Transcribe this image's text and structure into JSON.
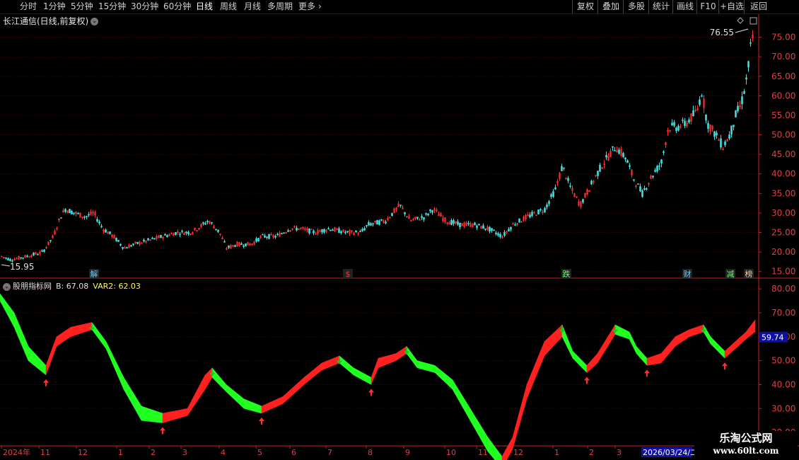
{
  "toolbar": {
    "periods": [
      "分时",
      "1分钟",
      "5分钟",
      "15分钟",
      "30分钟",
      "60分钟",
      "日线",
      "周线",
      "月线",
      "多周期",
      "更多"
    ],
    "active": "日线",
    "more_arrow": "chevron-right-icon",
    "right_buttons": [
      "复权",
      "叠加",
      "多股",
      "统计",
      "画线",
      "F10",
      "+自选",
      "返回"
    ]
  },
  "main_chart": {
    "title": "长江通信(日线,前复权)",
    "high_label": "76.55",
    "low_label": "15.95",
    "y_ticks": [
      "75.00",
      "70.00",
      "65.00",
      "60.00",
      "55.00",
      "50.00",
      "45.00",
      "40.00",
      "35.00",
      "30.00",
      "25.00",
      "20.00",
      "15.00"
    ],
    "markers": [
      {
        "text": "解",
        "color": "#66ccff"
      },
      {
        "text": "$",
        "color": "#ff3333"
      },
      {
        "text": "跌",
        "color": "#66ff66"
      },
      {
        "text": "财",
        "color": "#66ccff"
      },
      {
        "text": "减",
        "color": "#66ff66"
      },
      {
        "text": "榜",
        "color": "#ffcc88"
      }
    ]
  },
  "indicator": {
    "name": "股朋指标网",
    "b_label": "B: 67.08",
    "var2_label": "VAR2: 62.03",
    "y_ticks": [
      "80.00",
      "70.00",
      "60.00",
      "50.00",
      "40.00",
      "30.00",
      "20.00"
    ],
    "current_value": "59.74"
  },
  "x_axis": {
    "labels": [
      "2024年",
      "11",
      "12",
      "1",
      "2",
      "3",
      "4",
      "5",
      "6",
      "7",
      "8",
      "9",
      "10",
      "11",
      "12",
      "1",
      "2",
      "3"
    ],
    "cursor_date": "2026/03/24/二"
  },
  "watermark": {
    "line1": "乐淘公式网",
    "line2": "www.60lt.com"
  },
  "colors": {
    "up": "#ff2020",
    "down": "#20ff20",
    "grid": "#5a0000",
    "axis": "#cc2222"
  },
  "chart_data": {
    "type": "candlestick",
    "price_series": [
      [
        0,
        19
      ],
      [
        15,
        18
      ],
      [
        40,
        19
      ],
      [
        60,
        20
      ],
      [
        75,
        24
      ],
      [
        85,
        29
      ],
      [
        92,
        31
      ],
      [
        105,
        30
      ],
      [
        120,
        29
      ],
      [
        132,
        30
      ],
      [
        145,
        26
      ],
      [
        160,
        24
      ],
      [
        175,
        21
      ],
      [
        190,
        22
      ],
      [
        210,
        23
      ],
      [
        230,
        24
      ],
      [
        250,
        25
      ],
      [
        270,
        25
      ],
      [
        295,
        28
      ],
      [
        310,
        25
      ],
      [
        320,
        21
      ],
      [
        335,
        22
      ],
      [
        355,
        22
      ],
      [
        370,
        24
      ],
      [
        390,
        24
      ],
      [
        410,
        26
      ],
      [
        425,
        26
      ],
      [
        445,
        25
      ],
      [
        465,
        26
      ],
      [
        490,
        25
      ],
      [
        510,
        25
      ],
      [
        520,
        27
      ],
      [
        545,
        28
      ],
      [
        565,
        32
      ],
      [
        580,
        28
      ],
      [
        600,
        29
      ],
      [
        612,
        31
      ],
      [
        630,
        28
      ],
      [
        650,
        27
      ],
      [
        670,
        27
      ],
      [
        690,
        26
      ],
      [
        710,
        24
      ],
      [
        725,
        27
      ],
      [
        745,
        29
      ],
      [
        770,
        31
      ],
      [
        785,
        36
      ],
      [
        795,
        42
      ],
      [
        805,
        37
      ],
      [
        820,
        32
      ],
      [
        835,
        37
      ],
      [
        850,
        42
      ],
      [
        870,
        47
      ],
      [
        885,
        44
      ],
      [
        895,
        39
      ],
      [
        908,
        35
      ],
      [
        920,
        39
      ],
      [
        935,
        43
      ],
      [
        945,
        52
      ],
      [
        958,
        52
      ],
      [
        970,
        53
      ],
      [
        985,
        56
      ],
      [
        992,
        61
      ],
      [
        1000,
        53
      ],
      [
        1012,
        50
      ],
      [
        1022,
        47
      ],
      [
        1032,
        50
      ],
      [
        1040,
        55
      ],
      [
        1048,
        58
      ],
      [
        1055,
        64
      ],
      [
        1060,
        70
      ],
      [
        1063,
        76.55
      ],
      [
        1066,
        71
      ]
    ],
    "indicator_b": [
      [
        0,
        78
      ],
      [
        20,
        70
      ],
      [
        40,
        56
      ],
      [
        65,
        48
      ],
      [
        80,
        60
      ],
      [
        100,
        64
      ],
      [
        130,
        66
      ],
      [
        150,
        58
      ],
      [
        175,
        43
      ],
      [
        200,
        31
      ],
      [
        230,
        28
      ],
      [
        265,
        30
      ],
      [
        290,
        44
      ],
      [
        300,
        47
      ],
      [
        320,
        40
      ],
      [
        345,
        34
      ],
      [
        370,
        31
      ],
      [
        400,
        35
      ],
      [
        430,
        43
      ],
      [
        455,
        49
      ],
      [
        480,
        52
      ],
      [
        500,
        47
      ],
      [
        525,
        43
      ],
      [
        535,
        51
      ],
      [
        560,
        53
      ],
      [
        575,
        56
      ],
      [
        590,
        50
      ],
      [
        615,
        48
      ],
      [
        640,
        42
      ],
      [
        665,
        30
      ],
      [
        690,
        18
      ],
      [
        710,
        10
      ],
      [
        725,
        18
      ],
      [
        745,
        40
      ],
      [
        770,
        58
      ],
      [
        795,
        65
      ],
      [
        810,
        54
      ],
      [
        830,
        48
      ],
      [
        845,
        53
      ],
      [
        870,
        65
      ],
      [
        890,
        62
      ],
      [
        900,
        56
      ],
      [
        915,
        51
      ],
      [
        935,
        53
      ],
      [
        955,
        60
      ],
      [
        975,
        63
      ],
      [
        995,
        65
      ],
      [
        1005,
        60
      ],
      [
        1025,
        54
      ],
      [
        1040,
        58
      ],
      [
        1055,
        62
      ],
      [
        1068,
        67.08
      ]
    ],
    "indicator_var2": [
      [
        0,
        75
      ],
      [
        20,
        64
      ],
      [
        40,
        50
      ],
      [
        65,
        44
      ],
      [
        80,
        56
      ],
      [
        100,
        60
      ],
      [
        130,
        63
      ],
      [
        150,
        55
      ],
      [
        175,
        38
      ],
      [
        200,
        25
      ],
      [
        230,
        24
      ],
      [
        265,
        27
      ],
      [
        290,
        38
      ],
      [
        300,
        43
      ],
      [
        320,
        37
      ],
      [
        345,
        30
      ],
      [
        370,
        28
      ],
      [
        400,
        32
      ],
      [
        430,
        40
      ],
      [
        455,
        46
      ],
      [
        480,
        49
      ],
      [
        500,
        44
      ],
      [
        525,
        40
      ],
      [
        535,
        47
      ],
      [
        560,
        50
      ],
      [
        575,
        53
      ],
      [
        590,
        47
      ],
      [
        615,
        45
      ],
      [
        640,
        38
      ],
      [
        665,
        25
      ],
      [
        690,
        12
      ],
      [
        710,
        5
      ],
      [
        725,
        13
      ],
      [
        745,
        34
      ],
      [
        770,
        52
      ],
      [
        795,
        60
      ],
      [
        810,
        51
      ],
      [
        830,
        45
      ],
      [
        845,
        49
      ],
      [
        870,
        61
      ],
      [
        890,
        59
      ],
      [
        900,
        53
      ],
      [
        915,
        48
      ],
      [
        935,
        49
      ],
      [
        955,
        56
      ],
      [
        975,
        60
      ],
      [
        995,
        62
      ],
      [
        1005,
        57
      ],
      [
        1025,
        51
      ],
      [
        1040,
        55
      ],
      [
        1055,
        59
      ],
      [
        1068,
        62.03
      ]
    ],
    "main_ylim": [
      13.5,
      78
    ],
    "indicator_ylim": [
      15,
      83
    ]
  }
}
